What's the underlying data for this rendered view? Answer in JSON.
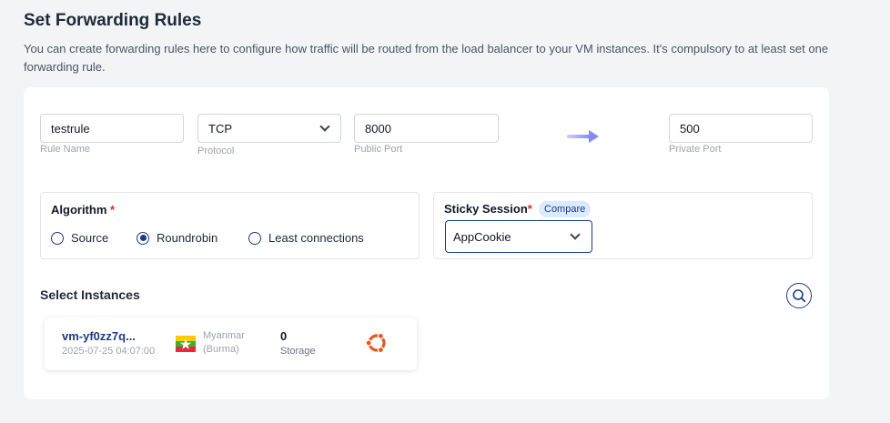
{
  "header": {
    "title": "Set Forwarding Rules",
    "description": "You can create forwarding rules here to configure how traffic will be routed from the load balancer to your VM instances. It's compulsory to at least set one forwarding rule."
  },
  "rule": {
    "name_value": "testrule",
    "name_label": "Rule Name",
    "protocol_value": "TCP",
    "protocol_label": "Protocol",
    "public_port_value": "8000",
    "public_port_label": "Public Port",
    "private_port_value": "500",
    "private_port_label": "Private Port"
  },
  "algorithm": {
    "title": "Algorithm",
    "required_mark": "*",
    "options": [
      "Source",
      "Roundrobin",
      "Least connections"
    ],
    "selected": "Roundrobin"
  },
  "sticky_session": {
    "title": "Sticky Session",
    "required_mark": "*",
    "compare_label": "Compare",
    "selected_value": "AppCookie"
  },
  "instances": {
    "title": "Select Instances",
    "items": [
      {
        "name": "vm-yf0zz7q...",
        "created": "2025-07-25 04:07:00",
        "region_line1": "Myanmar",
        "region_line2": "(Burma)",
        "storage_value": "0",
        "storage_label": "Storage",
        "flag_icon": "myanmar-flag-icon",
        "os_icon": "ubuntu-icon"
      }
    ]
  },
  "colors": {
    "accent": "#1e3a8a",
    "arrow": "#a5b4fc",
    "required": "#dc2626"
  }
}
